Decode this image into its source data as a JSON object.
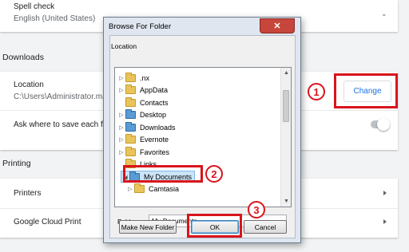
{
  "settings": {
    "spell_check": {
      "title": "Spell check",
      "value": "English (United States)"
    },
    "downloads_section": "Downloads",
    "location": {
      "title": "Location",
      "path": "C:\\Users\\Administrator.ma",
      "button": "Change"
    },
    "ask_where": "Ask where to save each file",
    "printing_section": "Printing",
    "printers": "Printers",
    "cloud_print": "Google Cloud Print"
  },
  "dialog": {
    "title": "Browse For Folder",
    "location_label": "Location",
    "tree": [
      {
        "label": ".nx",
        "expand": "right",
        "indent": 1,
        "icon": "folder-icon"
      },
      {
        "label": "AppData",
        "expand": "right",
        "indent": 1,
        "icon": "folder-icon"
      },
      {
        "label": "Contacts",
        "expand": "",
        "indent": 1,
        "icon": "contacts-icon"
      },
      {
        "label": "Desktop",
        "expand": "right",
        "indent": 1,
        "icon": "desktop-folder-icon"
      },
      {
        "label": "Downloads",
        "expand": "right",
        "indent": 1,
        "icon": "downloads-folder-icon"
      },
      {
        "label": "Evernote",
        "expand": "right",
        "indent": 1,
        "icon": "folder-icon"
      },
      {
        "label": "Favorites",
        "expand": "right",
        "indent": 1,
        "icon": "favorites-folder-icon"
      },
      {
        "label": "Links",
        "expand": "",
        "indent": 1,
        "icon": "links-folder-icon"
      },
      {
        "label": "My Documents",
        "expand": "down",
        "indent": 1,
        "icon": "documents-folder-icon",
        "selected": true
      },
      {
        "label": "Camtasia",
        "expand": "right",
        "indent": 2,
        "icon": "folder-icon"
      }
    ],
    "folder_label": "Folder:",
    "folder_value": "My Documents",
    "make_new_folder": "Make New Folder",
    "ok": "OK",
    "cancel": "Cancel",
    "close_glyph": "✕"
  },
  "callouts": [
    "1",
    "2",
    "3"
  ],
  "colors": {
    "callout_red": "#d9141c",
    "link_blue": "#1a73e8",
    "selection": "#cce4f7"
  }
}
